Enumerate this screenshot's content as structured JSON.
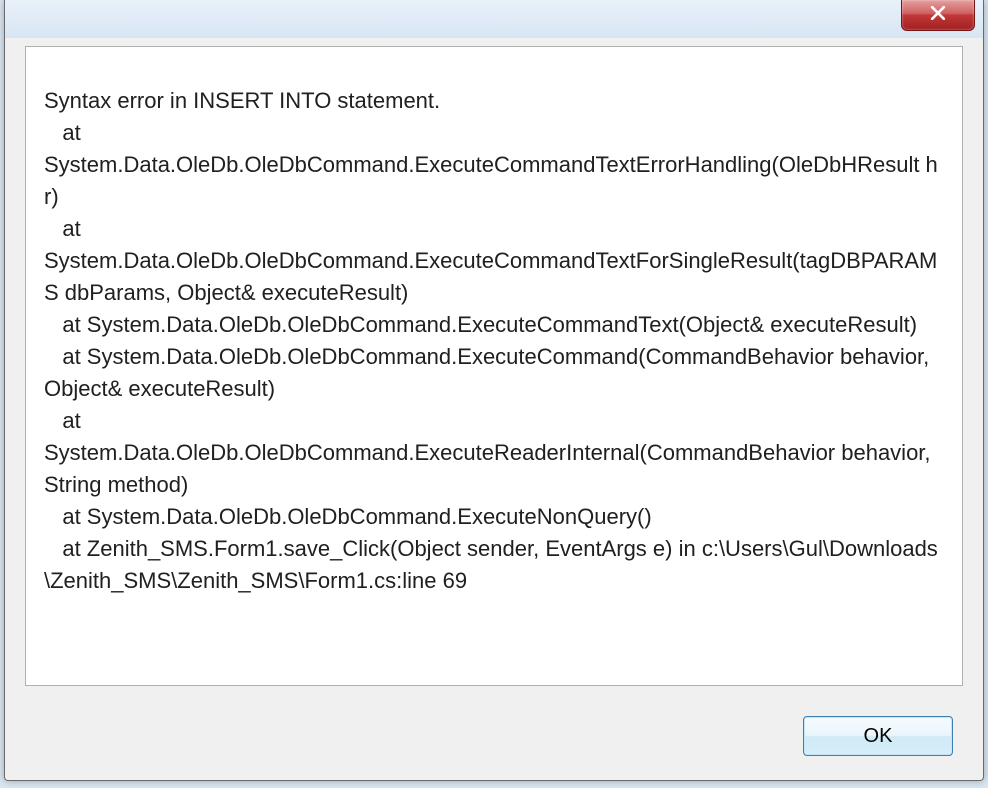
{
  "dialog": {
    "error_text": "Syntax error in INSERT INTO statement.\n   at\nSystem.Data.OleDb.OleDbCommand.ExecuteCommandTextErrorHandling(OleDbHResult hr)\n   at\nSystem.Data.OleDb.OleDbCommand.ExecuteCommandTextForSingleResult(tagDBPARAMS dbParams, Object& executeResult)\n   at System.Data.OleDb.OleDbCommand.ExecuteCommandText(Object& executeResult)\n   at System.Data.OleDb.OleDbCommand.ExecuteCommand(CommandBehavior behavior, Object& executeResult)\n   at\nSystem.Data.OleDb.OleDbCommand.ExecuteReaderInternal(CommandBehavior behavior, String method)\n   at System.Data.OleDb.OleDbCommand.ExecuteNonQuery()\n   at Zenith_SMS.Form1.save_Click(Object sender, EventArgs e) in c:\\Users\\Gul\\Downloads\\Zenith_SMS\\Zenith_SMS\\Form1.cs:line 69",
    "ok_label": "OK"
  }
}
